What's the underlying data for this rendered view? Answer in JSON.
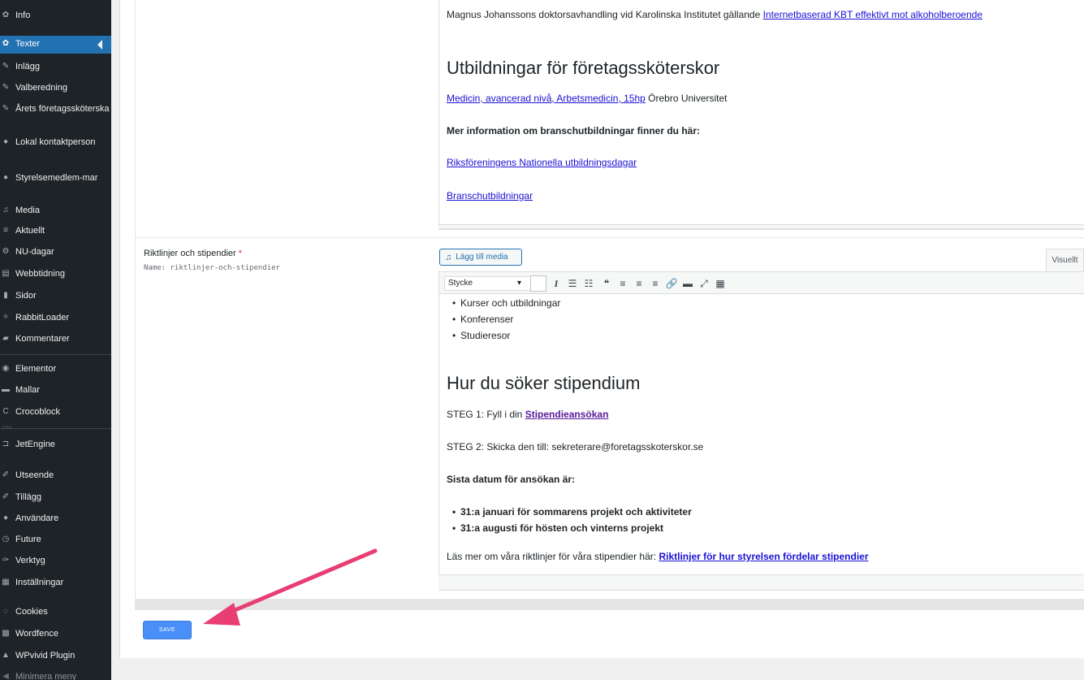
{
  "sidebar": {
    "items": [
      {
        "label": "Info",
        "icon": "gear-icon",
        "glyph": "✿"
      },
      {
        "label": "Texter",
        "icon": "gear-icon",
        "glyph": "✿",
        "active": true
      },
      {
        "label": "Inlägg",
        "icon": "pin-icon",
        "glyph": "✎"
      },
      {
        "label": "Valberedning",
        "icon": "pin-icon",
        "glyph": "✎"
      },
      {
        "label": "Årets företagssköterska",
        "icon": "pin-icon",
        "glyph": "✎"
      },
      {
        "label": "Lokal kontaktperson",
        "icon": "user-icon",
        "glyph": "●"
      },
      {
        "label": "Styrelsemedlem-mar",
        "icon": "user-icon",
        "glyph": "●"
      },
      {
        "label": "Media",
        "icon": "media-icon",
        "glyph": "♫"
      },
      {
        "label": "Aktuellt",
        "icon": "list-icon",
        "glyph": "≡"
      },
      {
        "label": "NU-dagar",
        "icon": "plugin-icon",
        "glyph": "⚙"
      },
      {
        "label": "Webbtidning",
        "icon": "newspaper-icon",
        "glyph": "▤"
      },
      {
        "label": "Sidor",
        "icon": "page-icon",
        "glyph": "▮"
      },
      {
        "label": "RabbitLoader",
        "icon": "rabbit-icon",
        "glyph": "✧"
      },
      {
        "label": "Kommentarer",
        "icon": "comment-icon",
        "glyph": "▰"
      },
      {
        "label": "Elementor",
        "icon": "elementor-icon",
        "glyph": "◉"
      },
      {
        "label": "Mallar",
        "icon": "folder-icon",
        "glyph": "▬"
      },
      {
        "label": "Crocoblock",
        "icon": "crocoblock-icon",
        "glyph": "C"
      },
      {
        "label": "JetEngine",
        "icon": "jetengine-icon",
        "glyph": "⊐"
      },
      {
        "label": "Utseende",
        "icon": "brush-icon",
        "glyph": "✐"
      },
      {
        "label": "Tillägg",
        "icon": "plugin-icon",
        "glyph": "✐"
      },
      {
        "label": "Användare",
        "icon": "user-icon",
        "glyph": "●"
      },
      {
        "label": "Future",
        "icon": "clock-icon",
        "glyph": "◷"
      },
      {
        "label": "Verktyg",
        "icon": "wrench-icon",
        "glyph": "✑"
      },
      {
        "label": "Inställningar",
        "icon": "settings-icon",
        "glyph": "▦"
      },
      {
        "label": "Cookies",
        "icon": "cookie-icon",
        "glyph": "◌"
      },
      {
        "label": "Wordfence",
        "icon": "wordfence-icon",
        "glyph": "▩"
      },
      {
        "label": "WPvivid Plugin",
        "icon": "wpvivid-icon",
        "glyph": "▲"
      },
      {
        "label": "Minimera meny",
        "icon": "collapse-icon",
        "glyph": "◀"
      }
    ],
    "small_label": "2.0.0"
  },
  "editor1": {
    "intro_text": "Magnus Johanssons doktorsavhandling vid Karolinska Institutet gällande ",
    "intro_link": "Internetbaserad KBT effektivt mot alkoholberoende",
    "heading": "Utbildningar för företagssköterskor",
    "course_link": "Medicin, avancerad nivå, Arbetsmedicin, 15hp",
    "course_suffix": " Örebro Universitet",
    "more_info": "Mer information om branschutbildningar finner du här:",
    "link1": "Riksföreningens Nationella utbildningsdagar",
    "link2": "Branschutbildningar"
  },
  "field": {
    "label": "Riktlinjer och stipendier",
    "required_mark": "*",
    "name_line": "Name: riktlinjer-och-stipendier"
  },
  "editor2": {
    "add_media_label": "Lägg till media",
    "tab_visual": "Visuellt",
    "format_value": "Stycke",
    "bullets_top": [
      "Kurser och utbildningar",
      "Konferenser",
      "Studieresor"
    ],
    "heading": "Hur du söker stipendium",
    "step1_prefix": "STEG 1: Fyll i din ",
    "step1_link": "Stipendieansökan",
    "step2": "STEG 2: Skicka den till: sekreterare@foretagsskoterskor.se",
    "deadline_heading": "Sista datum för ansökan är:",
    "deadlines": [
      "31:a januari för sommarens projekt och aktiviteter",
      "31:a augusti för hösten och vinterns projekt"
    ],
    "read_more_prefix": "Läs mer om våra riktlinjer för våra stipendier här: ",
    "read_more_link": "Riktlinjer för hur styrelsen fördelar stipendier"
  },
  "toolbar_icons": [
    {
      "name": "italic-icon",
      "glyph": "I"
    },
    {
      "name": "bullet-list-icon",
      "glyph": "☰"
    },
    {
      "name": "numbered-list-icon",
      "glyph": "☷"
    },
    {
      "name": "blockquote-icon",
      "glyph": "❝"
    },
    {
      "name": "align-left-icon",
      "glyph": "≡"
    },
    {
      "name": "align-center-icon",
      "glyph": "≡"
    },
    {
      "name": "align-right-icon",
      "glyph": "≡"
    },
    {
      "name": "link-icon",
      "glyph": "🔗"
    },
    {
      "name": "more-icon",
      "glyph": "▬"
    },
    {
      "name": "fullscreen-icon",
      "glyph": "⤢"
    },
    {
      "name": "toolbar-toggle-icon",
      "glyph": "▦"
    }
  ],
  "save_label": "SAVE",
  "annotation_color": "#e83e74"
}
